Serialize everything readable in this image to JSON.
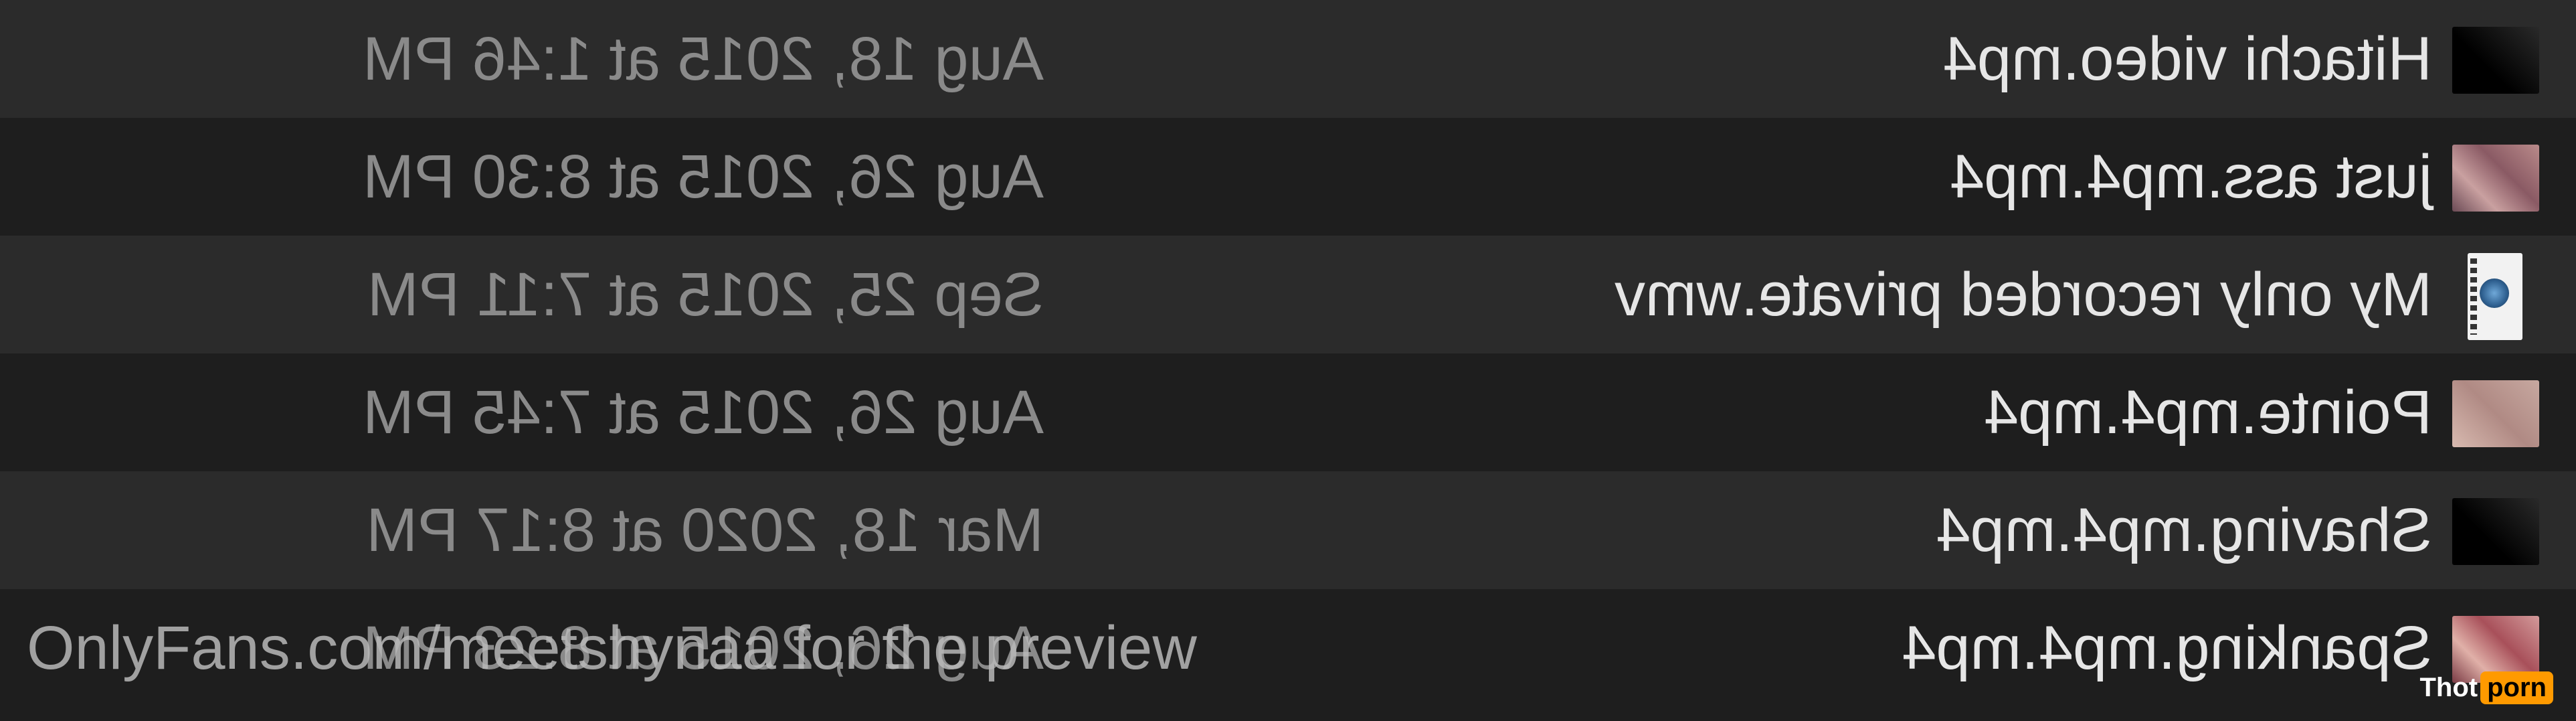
{
  "files": [
    {
      "name": "Hitachi video.mp4",
      "date": "Aug 18, 2015 at 1:46 PM",
      "thumb": "dark-video-thumbnail"
    },
    {
      "name": "just ass.mp4.mp4",
      "date": "Aug 26, 2015 at 8:30 PM",
      "thumb": "video-thumbnail"
    },
    {
      "name": "My only recorded private.wmv",
      "date": "Sep 25, 2015 at 7:11 PM",
      "thumb": "wmv-file-icon"
    },
    {
      "name": "Pointe.mp4.mp4",
      "date": "Aug 26, 2015 at 7:45 PM",
      "thumb": "video-thumbnail"
    },
    {
      "name": "Shaving.mp4.mp4",
      "date": "Mar 18, 2020 at 8:17 PM",
      "thumb": "dark-video-thumbnail"
    },
    {
      "name": "Spanking.mp4.mp4",
      "date": "Aug 26, 2015 at 8:23 PM",
      "thumb": "video-thumbnail"
    }
  ],
  "overlay": {
    "watermark_text": "OnlyFans.com/meetshynaa for the preview",
    "badge_part1": "Thot",
    "badge_part2": "porn"
  },
  "colors": {
    "row_light": "#2b2b2b",
    "row_dark": "#1e1e1e",
    "name_text": "#e6e6e6",
    "date_text": "#8a8a8a",
    "badge_accent": "#ff9a00"
  }
}
